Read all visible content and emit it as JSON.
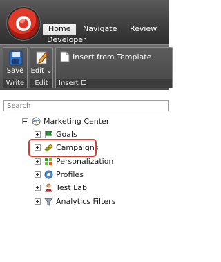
{
  "ribbon": {
    "tabs": [
      "Home",
      "Navigate",
      "Review",
      "Developer"
    ],
    "active_tab": "Home",
    "groups": {
      "write": {
        "label": "Write",
        "save_label": "Save"
      },
      "edit": {
        "label": "Edit",
        "edit_label": "Edit"
      },
      "insert": {
        "label": "Insert",
        "insert_template_label": "Insert from Template"
      }
    }
  },
  "search": {
    "placeholder": "Search"
  },
  "tree": {
    "root": {
      "label": "Marketing Center",
      "icon": "marketing-center-icon"
    },
    "items": [
      {
        "label": "Goals",
        "icon": "goals-flag-icon"
      },
      {
        "label": "Campaigns",
        "icon": "campaigns-icon",
        "highlighted": true
      },
      {
        "label": "Personalization",
        "icon": "personalization-icon"
      },
      {
        "label": "Profiles",
        "icon": "profiles-icon"
      },
      {
        "label": "Test Lab",
        "icon": "test-lab-icon"
      },
      {
        "label": "Analytics Filters",
        "icon": "analytics-filters-icon"
      }
    ]
  },
  "colors": {
    "highlight": "#e23a2a",
    "ribbon_dark": "#3d3d3d"
  }
}
